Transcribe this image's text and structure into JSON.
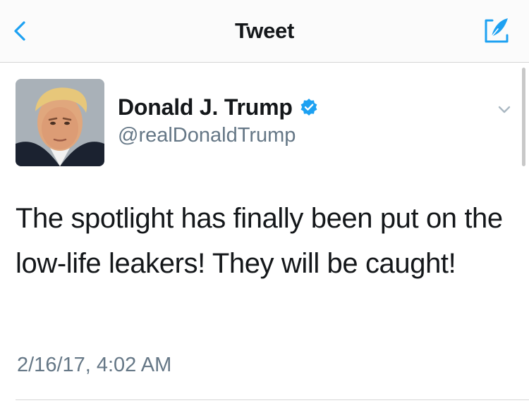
{
  "nav": {
    "title": "Tweet",
    "back_icon": "chevron-left-icon",
    "compose_icon": "compose-icon"
  },
  "tweet": {
    "author": {
      "display_name": "Donald J. Trump",
      "handle": "@realDonaldTrump",
      "verified": true
    },
    "text": "The spotlight has finally been put on the low-life leakers! They will be caught!",
    "timestamp": "2/16/17, 4:02 AM"
  },
  "colors": {
    "accent": "#1da1f2",
    "text": "#14171a",
    "secondary_text": "#657786",
    "divider": "#d6d6d6"
  }
}
